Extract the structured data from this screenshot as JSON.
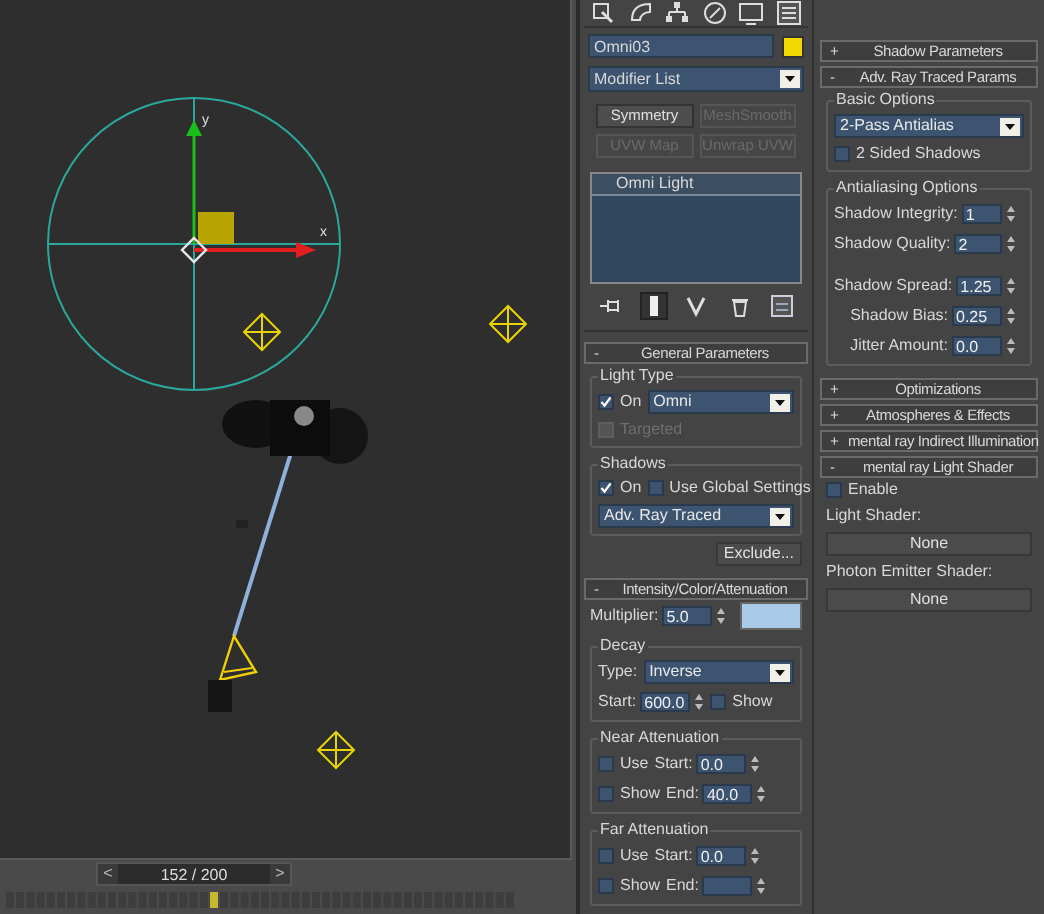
{
  "viewport": {
    "axis_labels": [
      "y",
      "x"
    ],
    "time_slider": {
      "prev": "<",
      "position": "152 / 200",
      "next": ">",
      "level": 0.41
    }
  },
  "command_panel": {
    "object": {
      "name": "Omni03",
      "color": "#f0d800"
    },
    "modifier_list": "Modifier List",
    "modifier_buttons": [
      {
        "label": "Symmetry",
        "disabled": false
      },
      {
        "label": "MeshSmooth",
        "disabled": true
      },
      {
        "label": "UVW Map",
        "disabled": true
      },
      {
        "label": "Unwrap UVW",
        "disabled": true
      }
    ],
    "stack": [
      "Omni Light"
    ],
    "stack_tools": [
      {
        "selected": false
      },
      {
        "selected": true
      },
      {
        "selected": false
      },
      {
        "selected": false
      },
      {
        "selected": false
      }
    ],
    "columns": [
      [
        {
          "sign": "-",
          "title": "General Parameters",
          "items": [
            {
              "kind": "group",
              "title": "Light Type",
              "items": [
                {
                  "kind": "row",
                  "items": [
                    {
                      "kind": "checkbox",
                      "label": "On",
                      "checked": true,
                      "disabled": false
                    },
                    {
                      "kind": "dropdown",
                      "value": "Omni"
                    }
                  ]
                },
                {
                  "kind": "checkbox",
                  "label": "Targeted",
                  "checked": false,
                  "disabled": true
                }
              ]
            },
            {
              "kind": "group",
              "title": "Shadows",
              "items": [
                {
                  "kind": "row",
                  "items": [
                    {
                      "kind": "checkbox",
                      "label": "On",
                      "checked": true,
                      "disabled": false
                    },
                    {
                      "kind": "checkbox",
                      "label": "Use Global Settings",
                      "checked": false,
                      "disabled": false
                    }
                  ]
                },
                {
                  "kind": "dropdown",
                  "value": "Adv. Ray Traced"
                }
              ]
            },
            {
              "kind": "button",
              "label": "Exclude..."
            }
          ]
        },
        {
          "sign": "-",
          "title": "Intensity/Color/Attenuation",
          "items": [
            {
              "kind": "row",
              "items": [
                {
                  "kind": "spinner",
                  "label": "Multiplier:",
                  "value": "5.0"
                },
                {
                  "kind": "swatch",
                  "color": "#a9cbe8"
                }
              ]
            },
            {
              "kind": "group",
              "title": "Decay",
              "items": [
                {
                  "kind": "dropdown",
                  "label": "Type:",
                  "value": "Inverse"
                },
                {
                  "kind": "row",
                  "items": [
                    {
                      "kind": "spinner",
                      "label": "Start:",
                      "value": "600.0"
                    },
                    {
                      "kind": "checkbox",
                      "label": "Show",
                      "checked": false,
                      "disabled": false
                    }
                  ]
                }
              ]
            },
            {
              "kind": "group",
              "title": "Near Attenuation",
              "items": [
                {
                  "kind": "row",
                  "items": [
                    {
                      "kind": "checkbox",
                      "label": "Use",
                      "checked": false,
                      "disabled": false
                    },
                    {
                      "kind": "spinner",
                      "label": "Start:",
                      "value": "0.0"
                    }
                  ]
                },
                {
                  "kind": "row",
                  "items": [
                    {
                      "kind": "checkbox",
                      "label": "Show",
                      "checked": false,
                      "disabled": false
                    },
                    {
                      "kind": "spinner",
                      "label": "End:",
                      "value": "40.0"
                    }
                  ]
                }
              ]
            },
            {
              "kind": "group",
              "title": "Far Attenuation",
              "items": [
                {
                  "kind": "row",
                  "items": [
                    {
                      "kind": "checkbox",
                      "label": "Use",
                      "checked": false,
                      "disabled": false
                    },
                    {
                      "kind": "spinner",
                      "label": "Start:",
                      "value": "0.0"
                    }
                  ]
                },
                {
                  "kind": "row",
                  "items": [
                    {
                      "kind": "checkbox",
                      "label": "Show",
                      "checked": false,
                      "disabled": false
                    },
                    {
                      "kind": "spinner",
                      "label": "End:"
                    }
                  ]
                }
              ]
            }
          ]
        }
      ],
      [
        {
          "sign": "+",
          "title": "Shadow Parameters"
        },
        {
          "sign": "-",
          "title": "Adv. Ray Traced Params",
          "items": [
            {
              "kind": "group",
              "title": "Basic Options",
              "items": [
                {
                  "kind": "dropdown",
                  "value": "2-Pass Antialias"
                },
                {
                  "kind": "checkbox",
                  "label": "2 Sided Shadows",
                  "checked": false,
                  "disabled": false
                }
              ]
            },
            {
              "kind": "group",
              "title": "Antialiasing Options",
              "items": [
                {
                  "kind": "spinner",
                  "label": "Shadow Integrity:",
                  "value": "1"
                },
                {
                  "kind": "spinner",
                  "label": "Shadow Quality:",
                  "value": "2"
                },
                {
                  "kind": "spacer"
                },
                {
                  "kind": "spinner",
                  "label": "Shadow Spread:",
                  "value": "1.25"
                },
                {
                  "kind": "spinner",
                  "label": "Shadow Bias:",
                  "value": "0.25"
                },
                {
                  "kind": "spinner",
                  "label": "Jitter Amount:",
                  "value": "0.0"
                }
              ]
            }
          ]
        },
        {
          "sign": "+",
          "title": "Optimizations"
        },
        {
          "sign": "+",
          "title": "Atmospheres & Effects"
        },
        {
          "sign": "+",
          "title": "mental ray Indirect Illumination"
        },
        {
          "sign": "-",
          "title": "mental ray Light Shader",
          "items": [
            {
              "kind": "checkbox",
              "label": "Enable",
              "checked": false,
              "disabled": false
            },
            {
              "kind": "text",
              "text": "Light Shader:"
            },
            {
              "kind": "wide_button",
              "label": "None"
            },
            {
              "kind": "text",
              "text": "Photon Emitter Shader:"
            },
            {
              "kind": "wide_button",
              "label": "None"
            }
          ]
        }
      ]
    ]
  }
}
